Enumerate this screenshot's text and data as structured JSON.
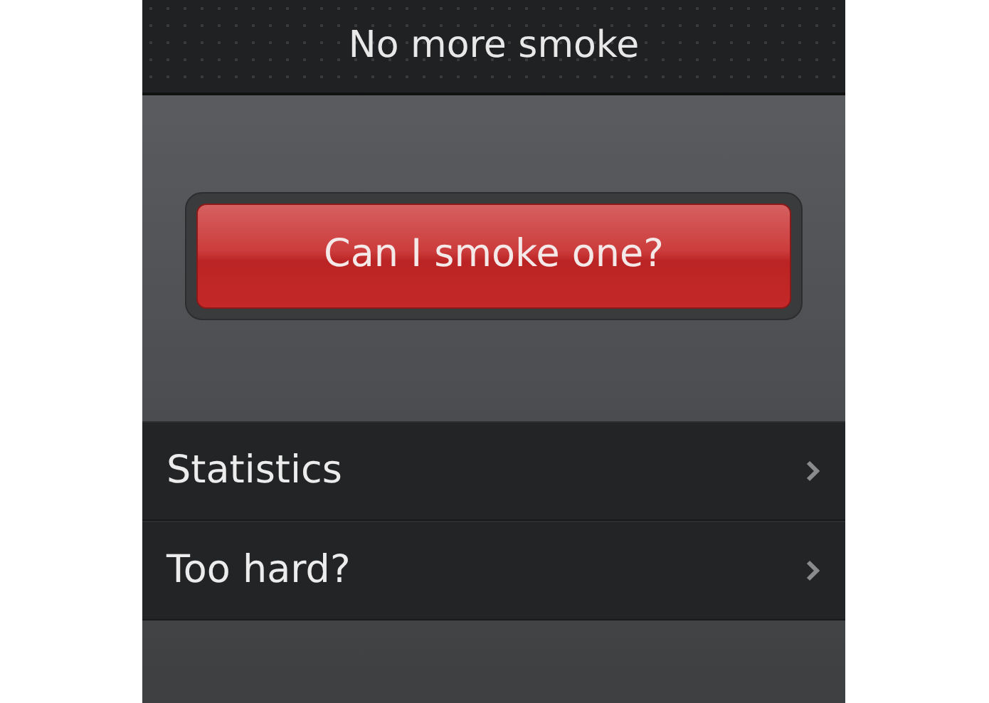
{
  "title_bar": {
    "title": "No more smoke"
  },
  "main_button": {
    "label": "Can I smoke one?"
  },
  "menu_items": [
    {
      "label": "Statistics"
    },
    {
      "label": "Too hard?"
    }
  ]
}
